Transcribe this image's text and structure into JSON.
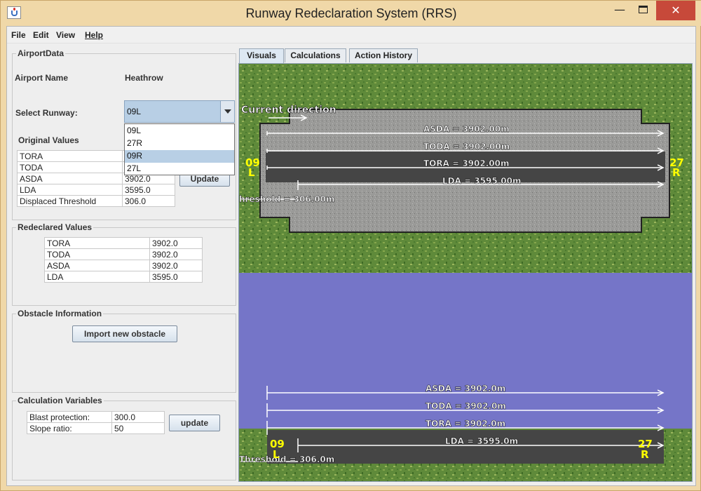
{
  "window": {
    "title": "Runway Redeclaration System (RRS)",
    "minimize_glyph": "—",
    "close_glyph": "✕"
  },
  "menu": [
    "File",
    "Edit",
    "View",
    "Help"
  ],
  "airport_data": {
    "group_title": "AirportData",
    "airport_name_label": "Airport Name",
    "airport_name": "Heathrow",
    "select_runway_label": "Select Runway:",
    "selected_runway": "09L",
    "runway_options": [
      "09L",
      "27R",
      "09R",
      "27L"
    ],
    "highlighted_option": "09R"
  },
  "original_values": {
    "group_title": "Original Values",
    "rows": [
      {
        "label": "TORA",
        "value": ""
      },
      {
        "label": "TODA",
        "value": ""
      },
      {
        "label": "ASDA",
        "value": "3902.0"
      },
      {
        "label": "LDA",
        "value": "3595.0"
      },
      {
        "label": "Displaced Threshold",
        "value": "306.0"
      }
    ],
    "update_button": "Update"
  },
  "redeclared_values": {
    "group_title": "Redeclared Values",
    "rows": [
      {
        "label": "TORA",
        "value": "3902.0"
      },
      {
        "label": "TODA",
        "value": "3902.0"
      },
      {
        "label": "ASDA",
        "value": "3902.0"
      },
      {
        "label": "LDA",
        "value": "3595.0"
      }
    ]
  },
  "obstacle_info": {
    "group_title": "Obstacle Information",
    "import_button": "Import new obstacle"
  },
  "calc_vars": {
    "group_title": "Calculation Variables",
    "rows": [
      {
        "label": "Blast protection:",
        "value": "300.0"
      },
      {
        "label": "Slope ratio:",
        "value": "50"
      }
    ],
    "update_button": "update"
  },
  "tabs": [
    "Visuals",
    "Calculations",
    "Action History"
  ],
  "active_tab": "Visuals",
  "visuals": {
    "top_view": {
      "current_direction_label": "Current direction",
      "asda": "ASDA = 3902.00m",
      "toda": "TODA = 3902.00m",
      "tora": "TORA = 3902.00m",
      "lda": "LDA = 3595.00m",
      "threshold": "hreshold = 306.00m",
      "left_designator_num": "09",
      "left_designator_letter": "L",
      "right_designator_num": "27",
      "right_designator_letter": "R"
    },
    "side_view": {
      "asda": "ASDA = 3902.0m",
      "toda": "TODA = 3902.0m",
      "tora": "TORA = 3902.0m",
      "lda": "LDA = 3595.0m",
      "threshold": "Threshold = 306.0m",
      "left_designator_num": "09",
      "left_designator_letter": "L",
      "right_designator_num": "27",
      "right_designator_letter": "R"
    },
    "colors": {
      "grass": "#5f8a3a",
      "tarmac_light": "#9a9a98",
      "tarmac_dark": "#454545",
      "sky": "#7575c8",
      "designator": "#ffff00",
      "arrow": "#ffffff"
    }
  }
}
